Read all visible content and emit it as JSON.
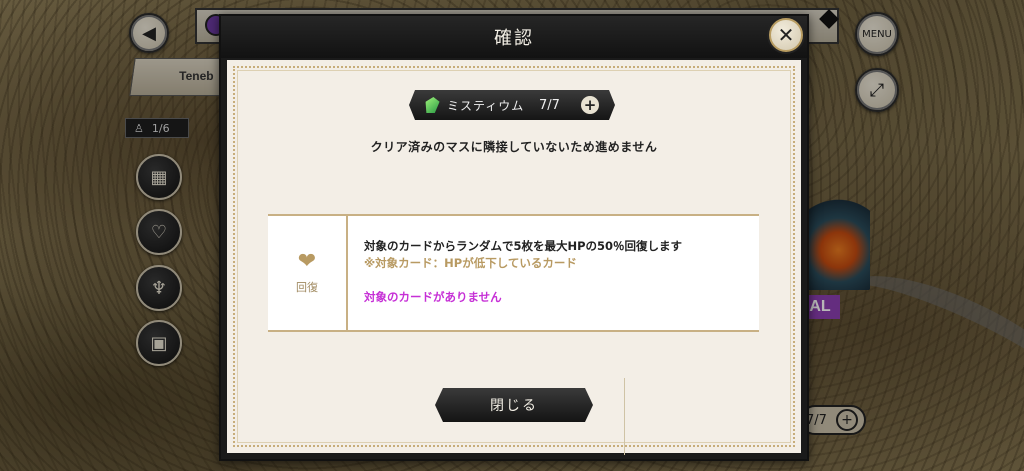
{
  "background": {
    "banner_text": "Teneb",
    "party_counter": "1/6",
    "boss_tag": "AL",
    "stamina": "7/7",
    "menu_label": "MENU"
  },
  "dialog": {
    "title": "確認",
    "currency": {
      "name": "ミスティウム",
      "value": "7/7",
      "icon": "crystal-icon"
    },
    "warning": "クリア済みのマスに隣接していないため進めません",
    "effect": {
      "icon": "heart-icon",
      "name": "回復",
      "description": "対象のカードからランダムで5枚を最大HPの50％回復します",
      "note": "※対象カード：HPが低下しているカード",
      "status": "対象のカードがありません"
    },
    "close_button": "閉じる"
  },
  "colors": {
    "accent_gold": "#c8b084",
    "status_magenta": "#c630d6",
    "boss_purple": "#8b3fb0"
  }
}
